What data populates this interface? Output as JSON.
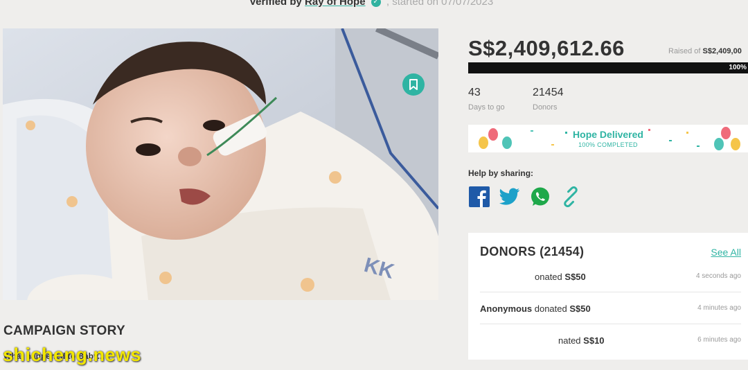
{
  "header": {
    "verified_prefix": "Verified by",
    "verified_org": "Ray of Hope",
    "started_text": ", started on 07/07/2023"
  },
  "hero": {
    "alt": "Baby in hospital bed with nasal feeding tube"
  },
  "stats": {
    "amount": "S$2,409,612.66",
    "raised_label": "Raised of",
    "raised_value": "S$2,409,00",
    "progress_percent": 100,
    "progress_label": "100%",
    "days_value": "43",
    "days_label": "Days to go",
    "donors_value": "21454",
    "donors_label": "Donors"
  },
  "banner": {
    "title": "Hope Delivered",
    "subtitle": "100% COMPLETED"
  },
  "share": {
    "title": "Help by sharing:",
    "icons": [
      "facebook-icon",
      "twitter-icon",
      "whatsapp-icon",
      "link-icon"
    ]
  },
  "donors_panel": {
    "title": "DONORS (21454)",
    "see_all": "See All",
    "rows": [
      {
        "name": "",
        "action": "nated",
        "prefix_clip": "o",
        "amount": "S$50",
        "time": "4 seconds ago"
      },
      {
        "name": "Anonymous",
        "action": " donated ",
        "amount": "S$50",
        "time": "4 minutes ago"
      },
      {
        "name": "",
        "action": "nated",
        "amount": "S$10",
        "time": "6 minutes ago"
      }
    ]
  },
  "story": {
    "title": "CAMPAIGN STORY",
    "subtitle": "What happened to Baby..."
  },
  "watermark": "shicheng.news",
  "colors": {
    "accent": "#2fb4a3",
    "progress": "#111111",
    "background": "#efeeec"
  }
}
